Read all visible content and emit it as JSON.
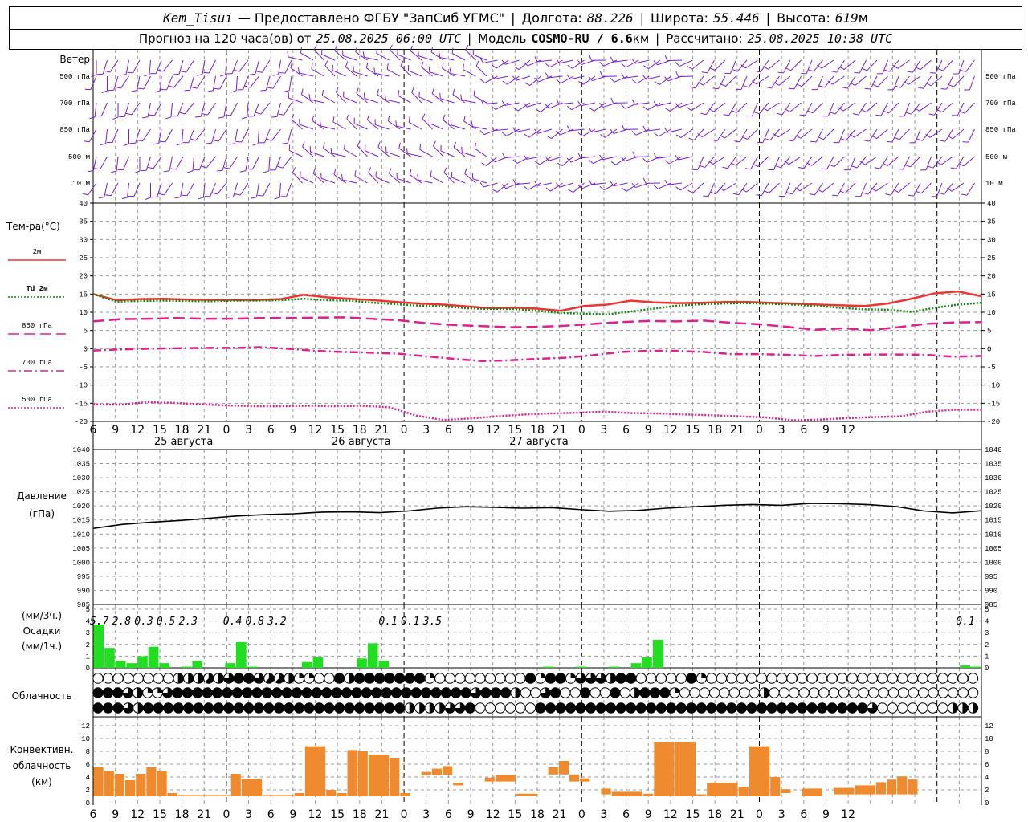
{
  "header": {
    "station": "Kem_Tisui",
    "provider": "— Предоставлено ФГБУ \"ЗапСиб УГМС\"",
    "lon_label": "Долгота:",
    "lon": "88.226",
    "lat_label": "Широта:",
    "lat": "55.446",
    "alt_label": "Высота:",
    "alt": "619",
    "alt_unit": "м",
    "forecast_label": "Прогноз на 120 часа(ов) от",
    "forecast_time": "25.08.2025 06:00 UTC",
    "model_label": "Модель",
    "model": "COSMO-RU / 6.6",
    "model_unit": "км",
    "calc_label": "Рассчитано:",
    "calc_time": "25.08.2025 10:38 UTC"
  },
  "wind_panel": {
    "title": "Ветер",
    "levels": [
      "500 гПа",
      "700 гПа",
      "850 гПа",
      "500 м",
      "10  м"
    ],
    "color": "#7b1fd8"
  },
  "chart_data": [
    {
      "type": "line",
      "title": "Тем-ра(°C)",
      "hours": [
        6,
        9,
        12,
        15,
        18,
        21,
        24,
        27,
        30,
        33,
        36,
        39,
        42,
        45,
        48,
        51,
        54,
        57,
        60,
        63,
        66,
        69,
        72,
        75,
        78,
        81,
        84,
        87,
        90,
        93,
        96,
        99,
        102,
        105,
        108,
        111,
        114,
        117,
        120,
        123,
        126
      ],
      "x_tick_labels": [
        "6",
        "9",
        "12",
        "15",
        "18",
        "21",
        "0",
        "3",
        "6",
        "9",
        "12",
        "15",
        "18",
        "21",
        "0",
        "3",
        "6",
        "9",
        "12",
        "15",
        "18",
        "21",
        "0",
        "3",
        "6",
        "9",
        "12",
        "15",
        "18",
        "21",
        "0",
        "3",
        "6",
        "9",
        "12"
      ],
      "day_labels": [
        "25 августа",
        "26 августа",
        "27 августа"
      ],
      "ylim": [
        -20,
        40
      ],
      "yticks": [
        -20,
        -15,
        -10,
        -5,
        0,
        5,
        10,
        15,
        20,
        25,
        30,
        35,
        40
      ],
      "series": [
        {
          "name": "2м",
          "color": "#ee3333",
          "dash": "solid",
          "values": [
            15,
            13.3,
            13.6,
            13.7,
            13.5,
            13.4,
            13.4,
            13.4,
            13.6,
            14.8,
            14.1,
            13.7,
            13.3,
            12.8,
            12.4,
            12.1,
            11.6,
            11.1,
            11.3,
            11,
            10.4,
            11.7,
            12.1,
            13.2,
            12.7,
            12.5,
            12.6,
            12.8,
            12.8,
            12.6,
            12.4,
            12.1,
            11.9,
            11.7,
            12.4,
            13.7,
            15.2,
            15.7,
            14.4
          ]
        },
        {
          "name": "Td  2м",
          "color": "#118811",
          "dash": "dot",
          "values": [
            15,
            12.9,
            13.1,
            13.2,
            13.1,
            13,
            13.2,
            13.2,
            13.3,
            13.7,
            13.3,
            13.2,
            12.6,
            12.2,
            11.8,
            11.6,
            11.1,
            10.9,
            10.9,
            10.4,
            9.8,
            9.6,
            9.4,
            10.2,
            11,
            11.8,
            12.2,
            12.4,
            12.5,
            12.3,
            12.1,
            11.7,
            11.2,
            10.8,
            10.7,
            10.1,
            11.2,
            12.1,
            12.6
          ]
        },
        {
          "name": "850 гПа",
          "color": "#e0208c",
          "dash": "long",
          "values": [
            7.5,
            8.1,
            8.2,
            8.4,
            8.2,
            8.2,
            8.4,
            8.4,
            8.5,
            8.6,
            8.2,
            7.8,
            7,
            6.5,
            6.2,
            5.9,
            6,
            6.3,
            6.8,
            7.3,
            7.6,
            7.5,
            7.7,
            7.1,
            6.7,
            6,
            5.2,
            5.6,
            5.1,
            5.9,
            6.8,
            7.2,
            7.3
          ]
        },
        {
          "name": "700 гПа",
          "color": "#e0208c",
          "dash": "dashdot",
          "values": [
            -0.5,
            -0.2,
            0,
            0.1,
            0.2,
            0.2,
            0.4,
            0,
            -0.6,
            -0.9,
            -1.1,
            -1.4,
            -2.1,
            -2.8,
            -3.4,
            -3.2,
            -2.8,
            -2.5,
            -1.8,
            -0.9,
            -0.6,
            -0.6,
            -0.9,
            -1.5,
            -1.5,
            -1.7,
            -2,
            -1.7,
            -1.6,
            -1.6,
            -1.7,
            -2.2,
            -2
          ]
        },
        {
          "name": "500 гПа",
          "color": "#e0208c",
          "dash": "dot",
          "values": [
            -15.3,
            -15.4,
            -14.7,
            -14.9,
            -15.3,
            -15.6,
            -15.8,
            -15.8,
            -15.7,
            -15.8,
            -15.7,
            -16.1,
            -18.4,
            -19.6,
            -19.2,
            -18.6,
            -18.1,
            -17.8,
            -17.6,
            -17.3,
            -17.7,
            -17.8,
            -18.1,
            -18.3,
            -18.6,
            -18.9,
            -19.7,
            -19.5,
            -19.1,
            -18.8,
            -18.6,
            -17.3,
            -16.8,
            -16.8
          ]
        }
      ]
    },
    {
      "type": "line",
      "title": "Давление",
      "ylabel": "(гПа)",
      "ylim": [
        985,
        1040
      ],
      "yticks": [
        985,
        990,
        995,
        1000,
        1005,
        1010,
        1015,
        1020,
        1025,
        1030,
        1035,
        1040
      ],
      "series": [
        {
          "name": "",
          "color": "#000000",
          "values": [
            1012,
            1013.4,
            1014.2,
            1014.8,
            1015.6,
            1016.4,
            1016.9,
            1017.2,
            1017.8,
            1017.9,
            1017.6,
            1018.2,
            1019.2,
            1019.7,
            1019.5,
            1019.2,
            1019.4,
            1018.7,
            1018.1,
            1018.4,
            1019.2,
            1019.7,
            1020.2,
            1020.5,
            1020.2,
            1020.9,
            1020.8,
            1020.5,
            1019.8,
            1018.2,
            1017.5,
            1018.3
          ]
        }
      ]
    },
    {
      "type": "bar",
      "title": "(мм/3ч.)",
      "subtitle": "Осадки",
      "ylabel": "(мм/1ч.)",
      "ylim": [
        0,
        5
      ],
      "yticks": [
        0,
        1,
        2,
        3,
        4,
        5
      ],
      "color": "#22dd22",
      "totals_3h": [
        {
          "hour": 9,
          "label": "5.7"
        },
        {
          "hour": 12,
          "label": "2.8"
        },
        {
          "hour": 15,
          "label": "0.3"
        },
        {
          "hour": 18,
          "label": "0.5"
        },
        {
          "hour": 21,
          "label": "2.3"
        },
        {
          "hour": 27,
          "label": "0.4"
        },
        {
          "hour": 30,
          "label": "0.8"
        },
        {
          "hour": 33,
          "label": "3.2"
        },
        {
          "hour": 48,
          "label": "0.1"
        },
        {
          "hour": 51,
          "label": "0.1"
        },
        {
          "hour": 54,
          "label": "3.5"
        },
        {
          "hour": 126,
          "label": "0.1"
        }
      ],
      "hourly": [
        3.7,
        1.7,
        0.6,
        0.4,
        1,
        1.8,
        0.4,
        0,
        0.1,
        0.6,
        0,
        0,
        0.4,
        2.2,
        0.1,
        0,
        0,
        0,
        0,
        0.5,
        0.9,
        0,
        0,
        0,
        0.8,
        2.1,
        0.6,
        0,
        0,
        0,
        0,
        0,
        0,
        0,
        0,
        0,
        0,
        0,
        0,
        0,
        0,
        0.1,
        0,
        0,
        0.1,
        0,
        0,
        0.1,
        0,
        0.4,
        0.9,
        2.4,
        0,
        0,
        0,
        0,
        0,
        0,
        0,
        0,
        0,
        0,
        0,
        0,
        0,
        0,
        0,
        0,
        0,
        0,
        0,
        0,
        0,
        0,
        0,
        0,
        0,
        0,
        0,
        0.2,
        0.1
      ]
    },
    {
      "type": "table",
      "title": "Облачность",
      "note": "cloud cover in eighths, rows = top / middle / low",
      "rows": [
        [
          0,
          0,
          0,
          0,
          0,
          0,
          0,
          0,
          4,
          4,
          4,
          5,
          4,
          6,
          8,
          8,
          6,
          5,
          5,
          4,
          2,
          2,
          0,
          0,
          8,
          4,
          8,
          8,
          8,
          8,
          8,
          8,
          8,
          2,
          0,
          0,
          0,
          0,
          0,
          0,
          0,
          0,
          0,
          8,
          2,
          8,
          8,
          2,
          6,
          6,
          6,
          4,
          8,
          8,
          0,
          0,
          0,
          0,
          0,
          8,
          2,
          0,
          0,
          0,
          0,
          0,
          0,
          0,
          0,
          0,
          0,
          0,
          0,
          0,
          0,
          0,
          0,
          0,
          0,
          0,
          0,
          0,
          0,
          0,
          0,
          0,
          0,
          0
        ],
        [
          8,
          8,
          8,
          6,
          4,
          2,
          2,
          6,
          8,
          8,
          8,
          8,
          8,
          8,
          8,
          8,
          8,
          8,
          8,
          8,
          8,
          8,
          8,
          8,
          8,
          8,
          8,
          8,
          8,
          8,
          8,
          8,
          8,
          8,
          8,
          8,
          8,
          8,
          6,
          8,
          8,
          8,
          4,
          0,
          0,
          6,
          8,
          0,
          0,
          8,
          0,
          0,
          8,
          0,
          4,
          8,
          8,
          8,
          2,
          0,
          0,
          0,
          0,
          0,
          0,
          0,
          0,
          4,
          0,
          0,
          0,
          0,
          0,
          0,
          0,
          0,
          0,
          0,
          0,
          0,
          0,
          0,
          0,
          0,
          0,
          0,
          0,
          0,
          0
        ],
        [
          8,
          8,
          8,
          6,
          4,
          8,
          8,
          8,
          8,
          8,
          8,
          8,
          8,
          8,
          8,
          8,
          8,
          8,
          8,
          8,
          8,
          8,
          8,
          8,
          8,
          8,
          8,
          8,
          8,
          8,
          8,
          4,
          4,
          4,
          4,
          6,
          6,
          8,
          0,
          0,
          0,
          0,
          0,
          0,
          8,
          8,
          8,
          8,
          8,
          8,
          8,
          8,
          8,
          8,
          8,
          8,
          8,
          8,
          8,
          8,
          8,
          8,
          8,
          8,
          8,
          8,
          8,
          8,
          8,
          8,
          8,
          8,
          8,
          8,
          8,
          8,
          8,
          6,
          0,
          0,
          0,
          0,
          0,
          0,
          0,
          4,
          4,
          4
        ]
      ]
    },
    {
      "type": "bar",
      "title": "Конвективн.",
      "subtitle": "облачность",
      "ylabel": "(км)",
      "ylim": [
        0,
        13
      ],
      "yticks": [
        0,
        2,
        4,
        6,
        8,
        10,
        12
      ],
      "color": "#f08a2e",
      "segments": [
        {
          "from": 6,
          "to": 7,
          "base": 1,
          "top": 5.5
        },
        {
          "from": 7,
          "to": 8,
          "base": 1,
          "top": 5
        },
        {
          "from": 8,
          "to": 9,
          "base": 1,
          "top": 4.5
        },
        {
          "from": 9,
          "to": 10,
          "base": 1,
          "top": 3.5
        },
        {
          "from": 10,
          "to": 11,
          "base": 1,
          "top": 4.5
        },
        {
          "from": 11,
          "to": 12,
          "base": 1,
          "top": 5.5
        },
        {
          "from": 12,
          "to": 13,
          "base": 1,
          "top": 5
        },
        {
          "from": 13,
          "to": 14,
          "base": 1,
          "top": 1.5
        },
        {
          "from": 14,
          "to": 19,
          "base": 1,
          "top": 1.2
        },
        {
          "from": 19,
          "to": 20,
          "base": 1,
          "top": 4.5
        },
        {
          "from": 20,
          "to": 22,
          "base": 1,
          "top": 3.7
        },
        {
          "from": 22,
          "to": 25,
          "base": 1,
          "top": 1.2
        },
        {
          "from": 25,
          "to": 26,
          "base": 1,
          "top": 1.5
        },
        {
          "from": 26,
          "to": 28,
          "base": 1,
          "top": 8.8
        },
        {
          "from": 28,
          "to": 29,
          "base": 1,
          "top": 2
        },
        {
          "from": 29,
          "to": 30,
          "base": 1,
          "top": 1.5
        },
        {
          "from": 30,
          "to": 31,
          "base": 1,
          "top": 8.2
        },
        {
          "from": 31,
          "to": 32,
          "base": 1,
          "top": 8
        },
        {
          "from": 32,
          "to": 34,
          "base": 1,
          "top": 7.5
        },
        {
          "from": 34,
          "to": 35,
          "base": 1,
          "top": 7
        },
        {
          "from": 35,
          "to": 36,
          "base": 1,
          "top": 1.5
        },
        {
          "from": 37,
          "to": 38,
          "base": 4.3,
          "top": 4.8
        },
        {
          "from": 38,
          "to": 39,
          "base": 4.3,
          "top": 5.3
        },
        {
          "from": 39,
          "to": 40,
          "base": 4.3,
          "top": 5.7
        },
        {
          "from": 40,
          "to": 41,
          "base": 2.7,
          "top": 3.1
        },
        {
          "from": 43,
          "to": 44,
          "base": 3.3,
          "top": 3.9
        },
        {
          "from": 44,
          "to": 46,
          "base": 3.3,
          "top": 4.3
        },
        {
          "from": 46,
          "to": 48,
          "base": 1,
          "top": 1.4
        },
        {
          "from": 49,
          "to": 50,
          "base": 4.4,
          "top": 5.5
        },
        {
          "from": 50,
          "to": 51,
          "base": 4.4,
          "top": 6.5
        },
        {
          "from": 51,
          "to": 52,
          "base": 3.3,
          "top": 4.4
        },
        {
          "from": 52,
          "to": 53,
          "base": 3.3,
          "top": 3.8
        },
        {
          "from": 54,
          "to": 55,
          "base": 1.3,
          "top": 2.2
        },
        {
          "from": 55,
          "to": 58,
          "base": 1,
          "top": 1.7
        },
        {
          "from": 58,
          "to": 59,
          "base": 1,
          "top": 1.4
        },
        {
          "from": 59,
          "to": 61,
          "base": 1,
          "top": 9.5
        },
        {
          "from": 61,
          "to": 63,
          "base": 1,
          "top": 9.5
        },
        {
          "from": 63,
          "to": 64,
          "base": 1,
          "top": 1.3
        },
        {
          "from": 64,
          "to": 67,
          "base": 1,
          "top": 3.1
        },
        {
          "from": 67,
          "to": 68,
          "base": 1,
          "top": 2.5
        },
        {
          "from": 68,
          "to": 70,
          "base": 1,
          "top": 8.8
        },
        {
          "from": 70,
          "to": 71,
          "base": 1,
          "top": 4
        },
        {
          "from": 71,
          "to": 72,
          "base": 1.5,
          "top": 2.1
        },
        {
          "from": 73,
          "to": 75,
          "base": 1,
          "top": 2.2
        },
        {
          "from": 76,
          "to": 78,
          "base": 1.3,
          "top": 2.3
        },
        {
          "from": 78,
          "to": 80,
          "base": 1.3,
          "top": 2.7
        },
        {
          "from": 80,
          "to": 81,
          "base": 1.3,
          "top": 3.2
        },
        {
          "from": 81,
          "to": 82,
          "base": 1.3,
          "top": 3.6
        },
        {
          "from": 82,
          "to": 83,
          "base": 1.3,
          "top": 4.1
        },
        {
          "from": 83,
          "to": 84,
          "base": 1.3,
          "top": 3.6
        }
      ]
    }
  ],
  "colors": {
    "grid": "#9a9a9a",
    "axis": "#000000"
  }
}
